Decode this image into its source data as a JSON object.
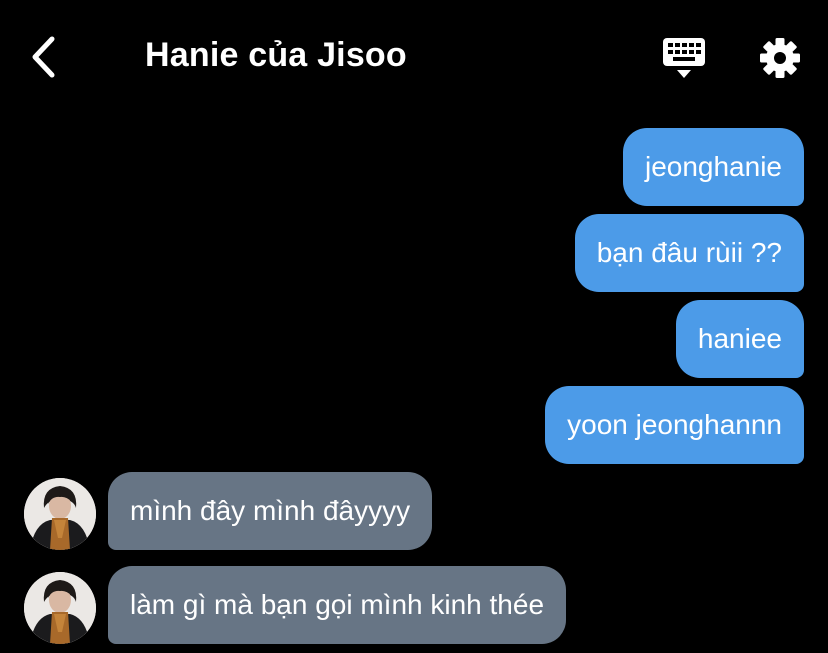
{
  "header": {
    "title": "Hanie của Jisoo"
  },
  "icons": {
    "back": "chevron-left-icon",
    "keyboard": "keyboard-icon",
    "settings": "gear-icon"
  },
  "colors": {
    "background": "#000000",
    "outgoing_bubble": "#4c9be8",
    "incoming_bubble": "#677585",
    "text": "#ffffff"
  },
  "messages": {
    "outgoing": [
      "jeonghanie",
      "bạn đâu rùii ??",
      "haniee",
      "yoon jeonghannn"
    ],
    "incoming": [
      "mình đây mình đâyyyy",
      "làm gì mà bạn gọi mình kinh thée"
    ]
  }
}
